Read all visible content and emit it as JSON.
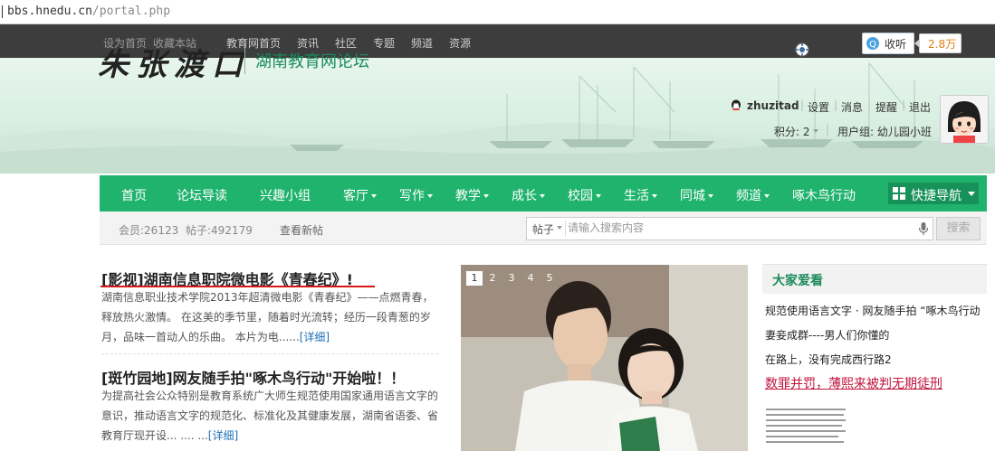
{
  "address_bar": {
    "domain": "bbs.hnedu.cn",
    "path": "/portal.php"
  },
  "topbar": {
    "set_home": "设为首页",
    "bookmark": "收藏本站",
    "links": [
      "教育网首页",
      "资讯",
      "社区",
      "专题",
      "频道",
      "资源"
    ],
    "listen_label": "收听",
    "listen_count": "2.8万"
  },
  "header": {
    "logo_text": "朱张渡口",
    "logo_subtitle": "湖南教育网论坛",
    "user": {
      "username": "zhuzitad",
      "links": [
        "设置",
        "消息",
        "提醒",
        "退出"
      ],
      "points": "积分: 2",
      "usergroup": "用户组: 幼儿园小班"
    }
  },
  "nav": {
    "items": [
      {
        "label": "首页",
        "dropdown": false
      },
      {
        "label": "论坛导读",
        "dropdown": false
      },
      {
        "label": "兴趣小组",
        "dropdown": false
      },
      {
        "label": "客厅",
        "dropdown": true
      },
      {
        "label": "写作",
        "dropdown": true
      },
      {
        "label": "教学",
        "dropdown": true
      },
      {
        "label": "成长",
        "dropdown": true
      },
      {
        "label": "校园",
        "dropdown": true
      },
      {
        "label": "生活",
        "dropdown": true
      },
      {
        "label": "同城",
        "dropdown": true
      },
      {
        "label": "频道",
        "dropdown": true
      },
      {
        "label": "啄木鸟行动",
        "dropdown": false
      }
    ],
    "quick_nav": "快捷导航"
  },
  "stats": {
    "members": "会员:26123",
    "posts": "帖子:492179",
    "new_posts": "查看新帖"
  },
  "search": {
    "type": "帖子",
    "placeholder": "请输入搜索内容",
    "button": "搜索"
  },
  "articles": [
    {
      "title": "[影视]湖南信息职院微电影《青春纪》!",
      "body": "湖南信息职业技术学院2013年超清微电影《青春纪》——点燃青春，释放热火激情。 在这美的季节里，随着时光流转；经历一段青葱的岁月，品味一首动人的乐曲。 本片为电......",
      "more": "[详细]"
    },
    {
      "title": "[斑竹园地]网友随手拍\"啄木鸟行动\"开始啦！！",
      "body": "为提高社会公众特别是教育系统广大师生规范使用国家通用语言文字的意识，推动语言文字的规范化、标准化及其健康发展，湖南省语委、省教育厅现开设... .... ...",
      "more": "[详细]"
    }
  ],
  "slideshow": {
    "pages": [
      "1",
      "2",
      "3",
      "4",
      "5"
    ],
    "active": 0
  },
  "popular": {
    "title": "大家爱看",
    "links": [
      {
        "text": "规范使用语言文字 · 网友随手拍 “啄木鸟行动",
        "highlight": false
      },
      {
        "text": "妻妾成群----男人们你懂的",
        "highlight": false
      },
      {
        "text": "在路上，没有完成西行路2",
        "highlight": false
      },
      {
        "text": "数罪并罚，薄熙来被判无期徒刑",
        "highlight": true
      }
    ]
  },
  "colors": {
    "nav_green": "#1fb36d",
    "topbar": "#3d3d3d",
    "logo_sub": "#1a8a5a",
    "headline_underline": "#d81818",
    "highlight_link": "#c0143c"
  }
}
